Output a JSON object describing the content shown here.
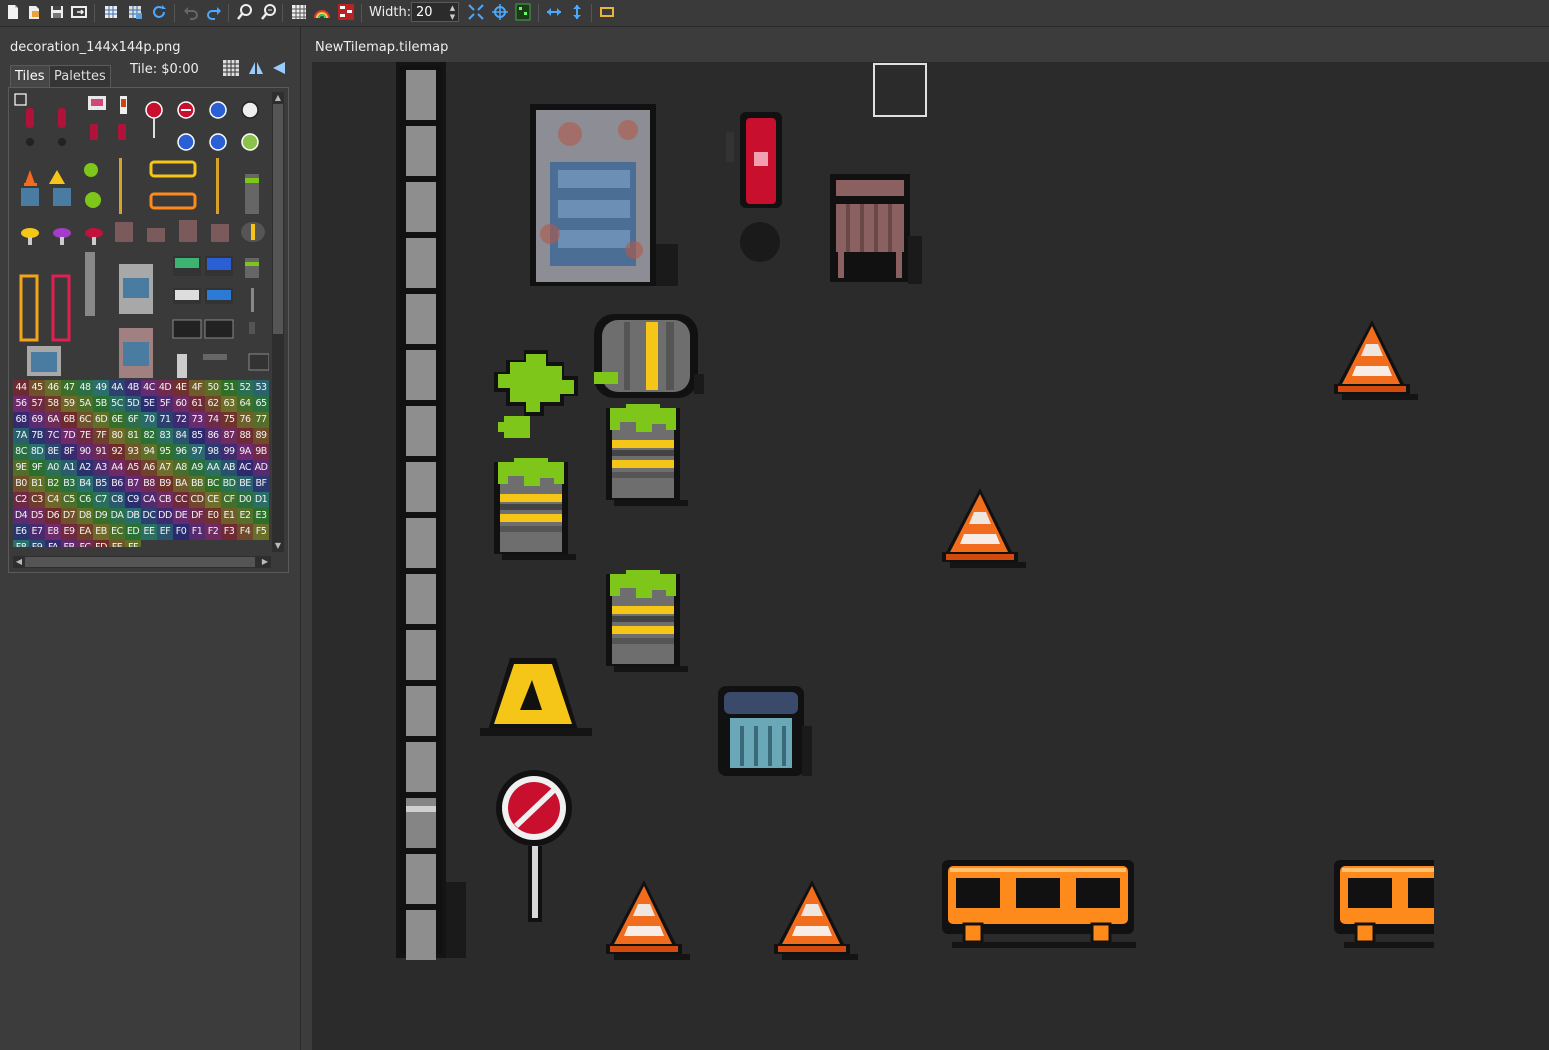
{
  "toolbar": {
    "width_label": "Width:",
    "width_value": "20",
    "icons": [
      "new-file-icon",
      "open-file-icon",
      "save-icon",
      "export-icon",
      "grid-icon",
      "grid-snap-icon",
      "refresh-icon",
      "undo-icon",
      "redo-icon",
      "zoom-in-icon",
      "zoom-out-icon",
      "tileset-grid-icon",
      "rainbow-icon",
      "palette-icon",
      "fit-icon",
      "center-icon",
      "minimap-icon",
      "flip-horizontal-icon",
      "flip-vertical-icon",
      "image-icon"
    ]
  },
  "left_panel": {
    "title": "decoration_144x144p.png",
    "tabs": [
      {
        "label": "Tiles",
        "active": true
      },
      {
        "label": "Palettes",
        "active": false
      }
    ],
    "tile_info": "Tile: $0:00",
    "hex_rows": [
      [
        "44",
        "45",
        "46",
        "47",
        "48",
        "49",
        "4A",
        "4B",
        "4C",
        "4D",
        "4E",
        "4F",
        "50",
        "51",
        "52",
        "53"
      ],
      [
        "56",
        "57",
        "58",
        "59",
        "5A",
        "5B",
        "5C",
        "5D",
        "5E",
        "5F",
        "60",
        "61",
        "62",
        "63",
        "64",
        "65"
      ],
      [
        "68",
        "69",
        "6A",
        "6B",
        "6C",
        "6D",
        "6E",
        "6F",
        "70",
        "71",
        "72",
        "73",
        "74",
        "75",
        "76",
        "77"
      ],
      [
        "7A",
        "7B",
        "7C",
        "7D",
        "7E",
        "7F",
        "80",
        "81",
        "82",
        "83",
        "84",
        "85",
        "86",
        "87",
        "88",
        "89"
      ],
      [
        "8C",
        "8D",
        "8E",
        "8F",
        "90",
        "91",
        "92",
        "93",
        "94",
        "95",
        "96",
        "97",
        "98",
        "99",
        "9A",
        "9B"
      ],
      [
        "9E",
        "9F",
        "A0",
        "A1",
        "A2",
        "A3",
        "A4",
        "A5",
        "A6",
        "A7",
        "A8",
        "A9",
        "AA",
        "AB",
        "AC",
        "AD"
      ],
      [
        "B0",
        "B1",
        "B2",
        "B3",
        "B4",
        "B5",
        "B6",
        "B7",
        "B8",
        "B9",
        "BA",
        "BB",
        "BC",
        "BD",
        "BE",
        "BF"
      ],
      [
        "C2",
        "C3",
        "C4",
        "C5",
        "C6",
        "C7",
        "C8",
        "C9",
        "CA",
        "CB",
        "CC",
        "CD",
        "CE",
        "CF",
        "D0",
        "D1"
      ],
      [
        "D4",
        "D5",
        "D6",
        "D7",
        "D8",
        "D9",
        "DA",
        "DB",
        "DC",
        "DD",
        "DE",
        "DF",
        "E0",
        "E1",
        "E2",
        "E3"
      ],
      [
        "E6",
        "E7",
        "E8",
        "E9",
        "EA",
        "EB",
        "EC",
        "ED",
        "EE",
        "EF",
        "F0",
        "F1",
        "F2",
        "F3",
        "F4",
        "F5"
      ],
      [
        "F8",
        "F9",
        "FA",
        "FB",
        "FC",
        "FD",
        "FE",
        "FF"
      ]
    ]
  },
  "document": {
    "tab_label": "NewTilemap.tilemap"
  },
  "colors": {
    "canvas_bg": "#2b2b2b",
    "panel_bg": "#3c3c3c",
    "cone_orange": "#f26c1d",
    "barrier_orange": "#ff8a1c",
    "slime_green": "#7ec61a",
    "stripe_yellow": "#f5c518",
    "sign_red": "#c8102e"
  }
}
